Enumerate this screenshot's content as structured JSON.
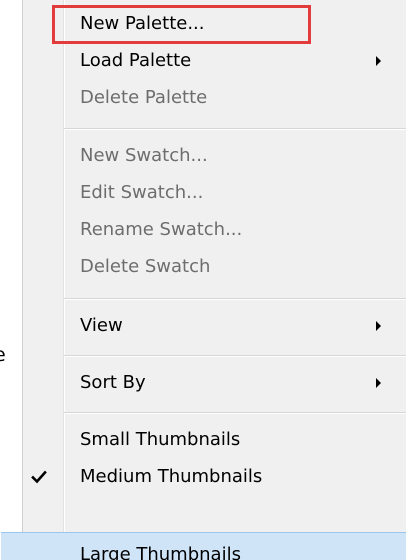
{
  "edge_fragment": "e",
  "menu": {
    "items": [
      {
        "label": "New Palette...",
        "enabled": true,
        "submenu": false
      },
      {
        "label": "Load Palette",
        "enabled": true,
        "submenu": true
      },
      {
        "label": "Delete Palette",
        "enabled": false,
        "submenu": false
      },
      {
        "label": "New Swatch...",
        "enabled": false,
        "submenu": false
      },
      {
        "label": "Edit Swatch...",
        "enabled": false,
        "submenu": false
      },
      {
        "label": "Rename Swatch...",
        "enabled": false,
        "submenu": false
      },
      {
        "label": "Delete Swatch",
        "enabled": false,
        "submenu": false
      },
      {
        "label": "View",
        "enabled": true,
        "submenu": true
      },
      {
        "label": "Sort By",
        "enabled": true,
        "submenu": true
      },
      {
        "label": "Small Thumbnails",
        "enabled": true,
        "submenu": false
      },
      {
        "label": "Medium Thumbnails",
        "enabled": true,
        "submenu": false,
        "checked": true
      },
      {
        "label": "Large Thumbnails",
        "enabled": true,
        "submenu": false,
        "hovered": true
      }
    ]
  },
  "colors": {
    "highlight_outline": "#e23b3b",
    "hover_background": "#cfe4f7",
    "menu_background": "#f0f0f0",
    "disabled_text": "#6d6d6d"
  },
  "icons": {
    "checkmark": "checkmark-icon",
    "submenu_arrow": "chevron-right-icon"
  }
}
